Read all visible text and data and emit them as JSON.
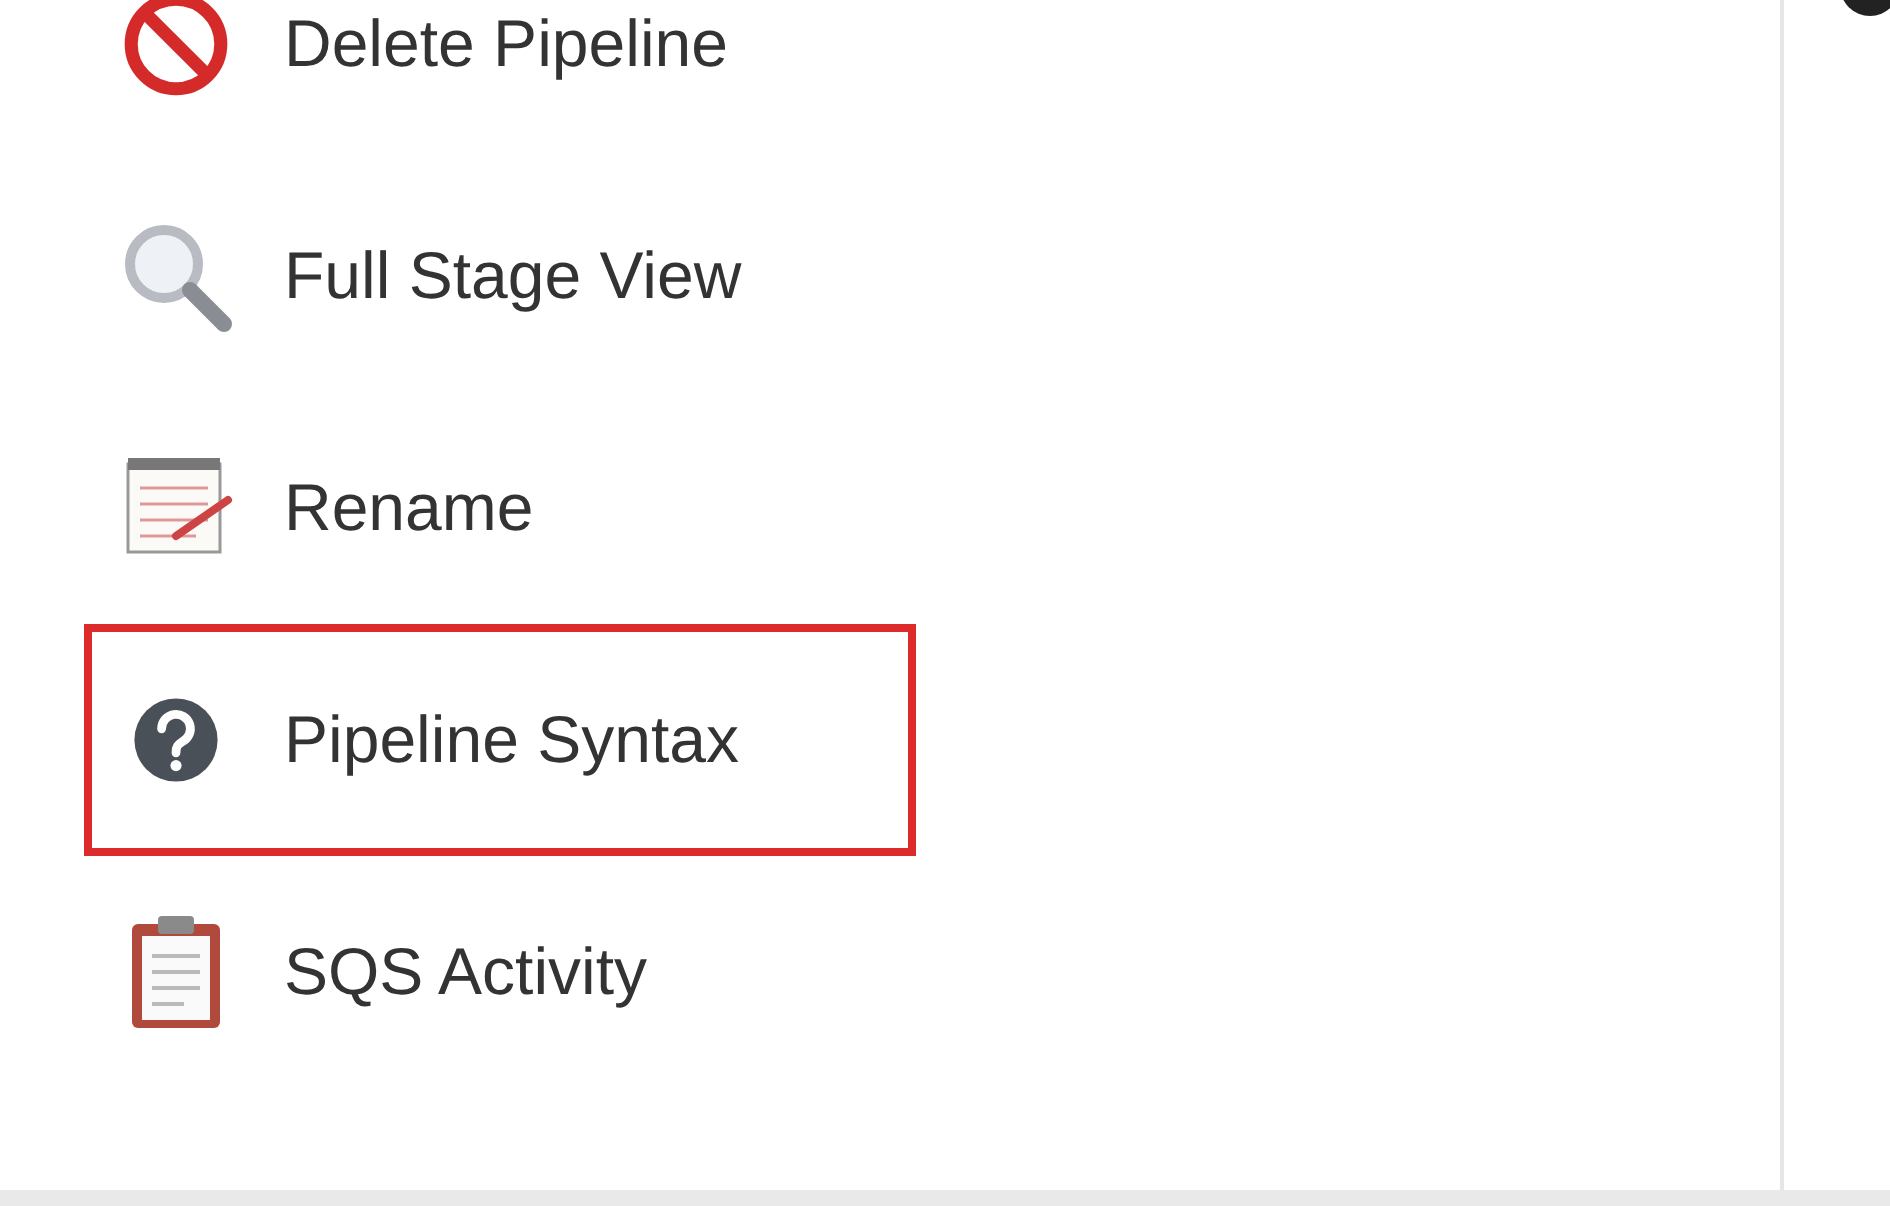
{
  "sidebar": {
    "items": [
      {
        "label": "Delete Pipeline",
        "highlighted": false
      },
      {
        "label": "Full Stage View",
        "highlighted": false
      },
      {
        "label": "Rename",
        "highlighted": false
      },
      {
        "label": "Pipeline Syntax",
        "highlighted": true
      },
      {
        "label": "SQS Activity",
        "highlighted": false
      }
    ]
  }
}
